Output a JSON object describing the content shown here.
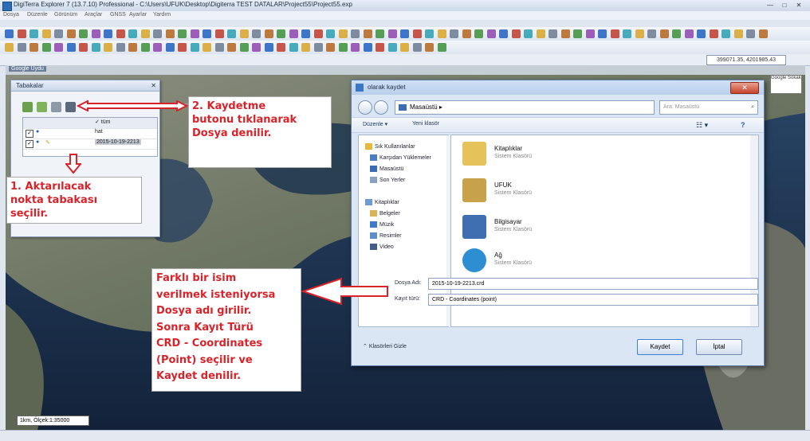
{
  "window": {
    "title": "DigiTerra Explorer 7 (13.7.10) Professional - C:\\Users\\UFUK\\Desktop\\Digiterra TEST DATALAR\\Project55\\Project55.exp",
    "min": "—",
    "max": "□",
    "close": "✕"
  },
  "menu": [
    "Dosya",
    "Düzenle",
    "Görünüm",
    "Araçlar",
    "GNSS",
    "Ayarlar",
    "Yardım"
  ],
  "coordbar": {
    "value": "399071.35, 4201985.43"
  },
  "map": {
    "header_label": "Google Uydu",
    "right_label": "Google Sokak",
    "scale_text": "1km, Ölçek:1:35000"
  },
  "layers_panel": {
    "title": "Tabakalar",
    "close": "✕",
    "rows": [
      {
        "name": "✓ tüm"
      },
      {
        "name": "hat"
      },
      {
        "name": "2015-10-19-2213"
      }
    ]
  },
  "dialog": {
    "title": "olarak kaydet",
    "close": "✕",
    "address": "Masaüstü ▸",
    "search_placeholder": "Ara: Masaüstü",
    "cmd_organize": "Düzenle ▾",
    "cmd_newfolder": "Yeni klasör",
    "nav_items": [
      {
        "label": "Sık Kullanılanlar",
        "color": "#e7b83a"
      },
      {
        "label": "Karşıdan Yüklemeler",
        "color": "#4a7fc0"
      },
      {
        "label": "Masaüstü",
        "color": "#3b6cb3"
      },
      {
        "label": "Son Yerler",
        "color": "#8aa2c2"
      },
      {
        "label": "Kitaplıklar",
        "color": "#6c9bd1"
      },
      {
        "label": "Belgeler",
        "color": "#d9b35c"
      },
      {
        "label": "Müzik",
        "color": "#3f7bc7"
      },
      {
        "label": "Resimler",
        "color": "#5f8fca"
      },
      {
        "label": "Video",
        "color": "#445e8c"
      }
    ],
    "files": [
      {
        "name": "Kitaplıklar",
        "sub": "Sistem Klasörü",
        "color": "#e6c25a"
      },
      {
        "name": "UFUK",
        "sub": "Sistem Klasörü",
        "color": "#c8a24a"
      },
      {
        "name": "Bilgisayar",
        "sub": "Sistem Klasörü",
        "color": "#3f6fb0"
      },
      {
        "name": "Ağ",
        "sub": "Sistem Klasörü",
        "color": "#2d8fd1"
      }
    ],
    "filename_label": "Dosya Adı:",
    "filename_value": "2015-10-19-2213.crd",
    "filetype_label": "Kayıt türü:",
    "filetype_value": "CRD - Coordinates (point)",
    "hide_folders": "Klasörleri Gizle",
    "save_button": "Kaydet",
    "cancel_button": "İptal"
  },
  "annotations": {
    "note1": [
      "1. Aktarılacak",
      "nokta tabakası",
      "seçilir."
    ],
    "note2": [
      "2. Kaydetme",
      "butonu tıklanarak",
      "Dosya denilir."
    ],
    "note3": [
      "Farklı bir isim",
      "verilmek isteniyorsa",
      "Dosya adı girilir.",
      "Sonra Kayıt Türü",
      "CRD - Coordinates",
      "(Point) seçilir ve",
      "Kaydet denilir."
    ],
    "color": "#d8232a"
  }
}
